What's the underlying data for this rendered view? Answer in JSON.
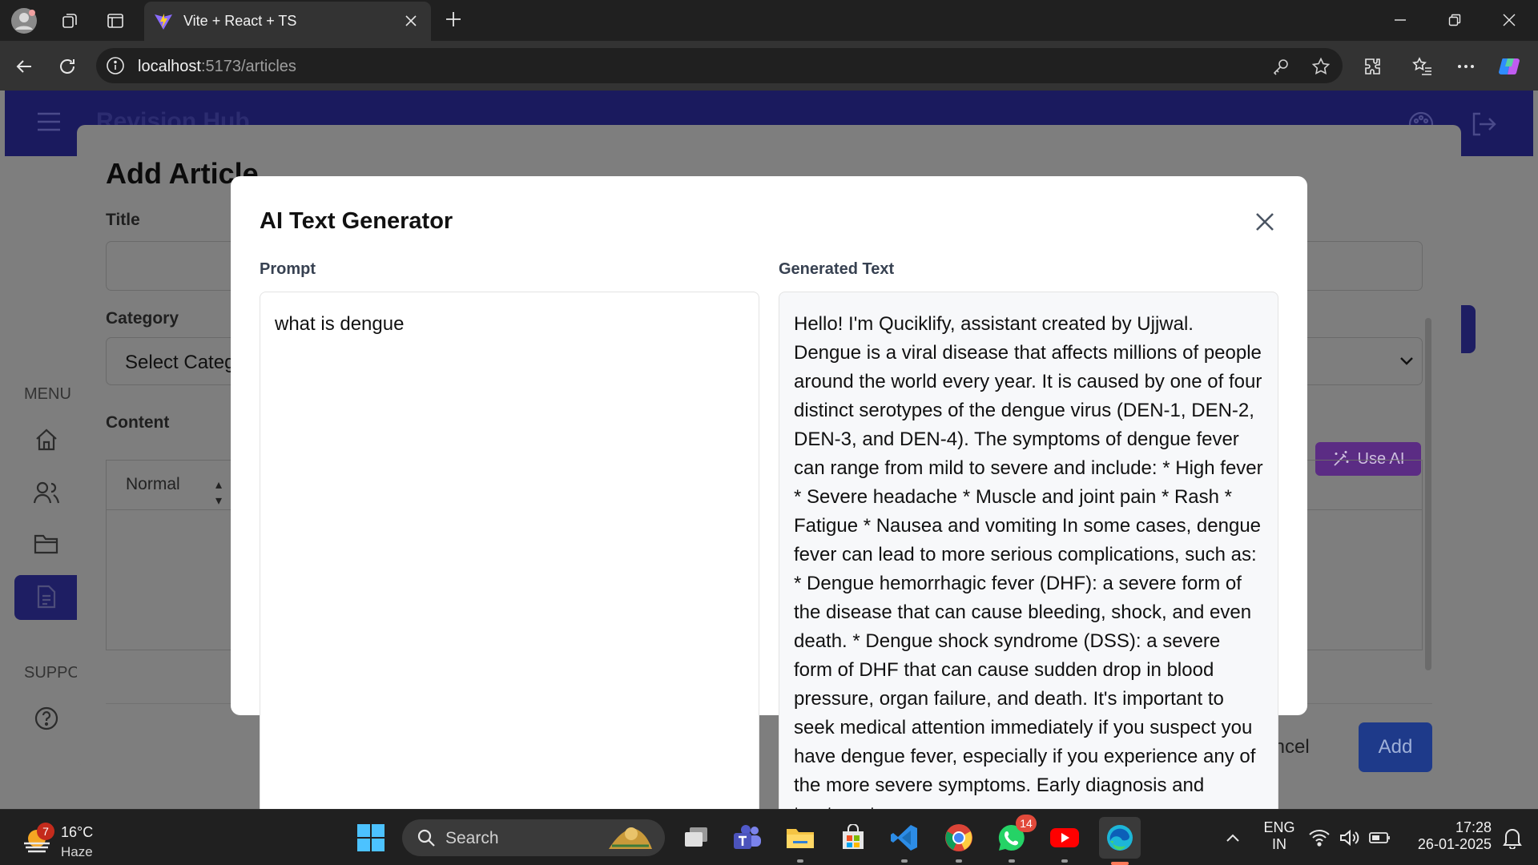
{
  "browser": {
    "tab_title": "Vite + React + TS",
    "url_host": "localhost",
    "url_rest": ":5173/articles"
  },
  "app": {
    "brand": "Revision Hub",
    "sidebar_menu_heading": "MENU",
    "sidebar_support_heading": "SUPPO"
  },
  "add_article": {
    "title": "Add Article",
    "title_label": "Title",
    "category_label": "Category",
    "category_placeholder": "Select Category",
    "content_label": "Content",
    "editor_format": "Normal",
    "use_ai_label": "Use AI",
    "cancel_label": "Cancel",
    "add_label": "Add"
  },
  "ai_generator": {
    "title": "AI Text Generator",
    "prompt_label": "Prompt",
    "generated_label": "Generated Text",
    "prompt_value": "what is dengue",
    "generated_text": "Hello! I'm Quciklify, assistant created by Ujjwal. Dengue is a viral disease that affects millions of people around the world every year. It is caused by one of four distinct serotypes of the dengue virus (DEN-1, DEN-2, DEN-3, and DEN-4). The symptoms of dengue fever can range from mild to severe and include: * High fever * Severe headache * Muscle and joint pain * Rash * Fatigue * Nausea and vomiting In some cases, dengue fever can lead to more serious complications, such as: * Dengue hemorrhagic fever (DHF): a severe form of the disease that can cause bleeding, shock, and even death. * Dengue shock syndrome (DSS): a severe form of DHF that can cause sudden drop in blood pressure, organ failure, and death. It's important to seek medical attention immediately if you suspect you have dengue fever, especially if you experience any of the more severe symptoms. Early diagnosis and treatment can"
  },
  "taskbar": {
    "weather_temp": "16°C",
    "weather_condition": "Haze",
    "weather_badge": "7",
    "search_placeholder": "Search",
    "whatsapp_badge": "14",
    "language_line1": "ENG",
    "language_line2": "IN",
    "time": "17:28",
    "date": "26-01-2025"
  },
  "colors": {
    "accent_purple": "#7c3aed",
    "accent_blue": "#1e40af",
    "app_header": "#1a1a5e"
  }
}
